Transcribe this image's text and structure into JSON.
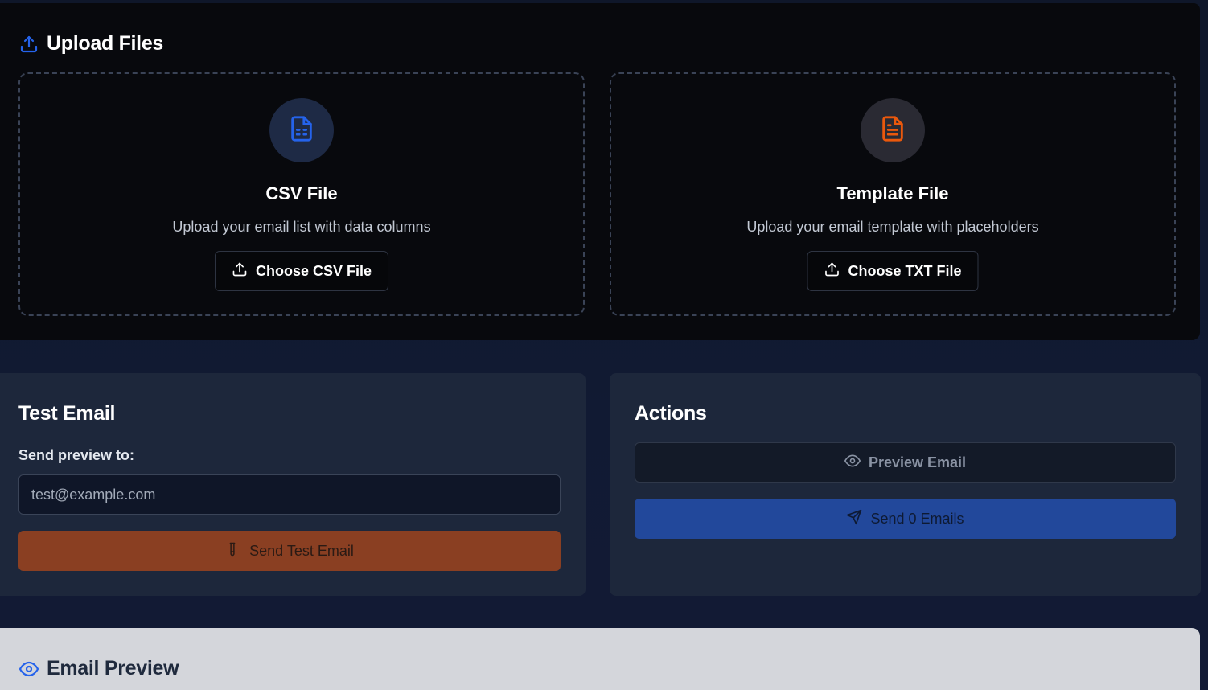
{
  "upload": {
    "title": "Upload Files",
    "csv": {
      "heading": "CSV File",
      "description": "Upload your email list with data columns",
      "button_label": "Choose CSV File"
    },
    "template": {
      "heading": "Template File",
      "description": "Upload your email template with placeholders",
      "button_label": "Choose TXT File"
    }
  },
  "test_email": {
    "title": "Test Email",
    "field_label": "Send preview to:",
    "input_value": "",
    "input_placeholder": "test@example.com",
    "button_label": "Send Test Email"
  },
  "actions": {
    "title": "Actions",
    "preview_label": "Preview Email",
    "send_label": "Send 0 Emails"
  },
  "email_preview": {
    "title": "Email Preview"
  },
  "colors": {
    "accent_blue": "#2563eb",
    "accent_orange": "#ea580c",
    "send_test_bg": "#8a3f22",
    "send_all_bg": "#22489b"
  },
  "icons": {
    "upload_title": "upload-icon",
    "csv": "file-spreadsheet-icon",
    "template": "file-text-icon",
    "choose": "upload-icon",
    "send_test": "test-tube-icon",
    "preview": "eye-icon",
    "send": "send-icon",
    "email_preview": "eye-icon"
  }
}
